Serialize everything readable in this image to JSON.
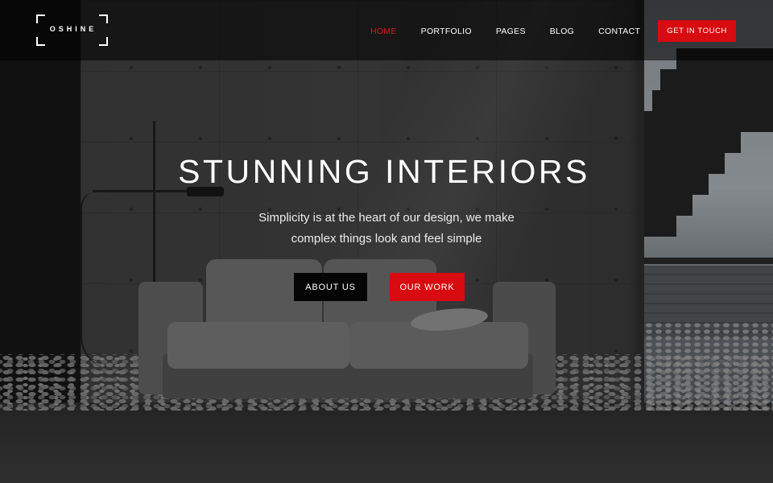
{
  "header": {
    "logo_text": "OSHINE",
    "nav": [
      {
        "label": "HOME",
        "active": true
      },
      {
        "label": "PORTFOLIO",
        "active": false
      },
      {
        "label": "PAGES",
        "active": false
      },
      {
        "label": "BLOG",
        "active": false
      },
      {
        "label": "CONTACT",
        "active": false
      }
    ],
    "cta_label": "GET IN TOUCH"
  },
  "hero": {
    "title": "STUNNING INTERIORS",
    "subtitle_line1": "Simplicity is at the heart of our design, we make",
    "subtitle_line2": "complex things look and feel simple",
    "buttons": {
      "primary_label": "ABOUT US",
      "secondary_label": "OUR WORK"
    },
    "background": "interior-photo-sofa-concrete-wall"
  },
  "colors": {
    "accent": "#d70b10",
    "active_nav": "#e4141b",
    "header_bg": "rgba(0,0,0,0.55)",
    "dark_button": "#050505"
  }
}
